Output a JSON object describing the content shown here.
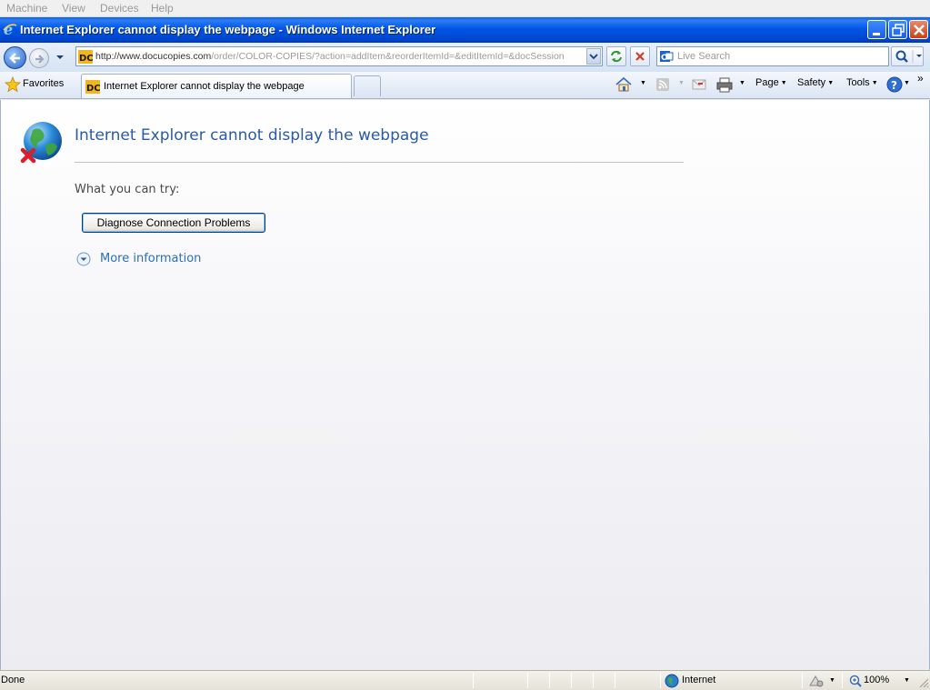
{
  "vm_menu": [
    "Machine",
    "View",
    "Devices",
    "Help"
  ],
  "window": {
    "title": "Internet Explorer cannot display the webpage - Windows Internet Explorer",
    "icon": "ie-logo-icon"
  },
  "navbar": {
    "url_host": "http://www.docucopies.com",
    "url_path": "/order/COLOR-COPIES/?action=addItem&reorderItemId=&editItemId=&docSession",
    "search_placeholder": "Live Search"
  },
  "favbar": {
    "favorites_label": "Favorites",
    "tab_title": "Internet Explorer cannot display the webpage",
    "commands": {
      "page": "Page",
      "safety": "Safety",
      "tools": "Tools"
    },
    "overflow": "»"
  },
  "content": {
    "heading": "Internet Explorer cannot display the webpage",
    "try_header": "What you can try:",
    "diagnose_button": "Diagnose Connection Problems",
    "more_info": "More information"
  },
  "status": {
    "text": "Done",
    "zone": "Internet",
    "zoom": "100%"
  },
  "colors": {
    "titlebar": "#0055e5",
    "heading": "#2b5aa6",
    "link": "#2b6fb6"
  }
}
